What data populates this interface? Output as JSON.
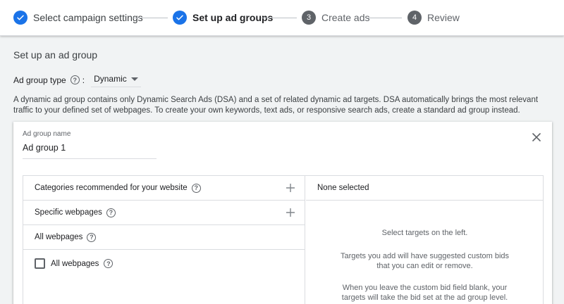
{
  "stepper": {
    "steps": [
      {
        "label": "Select campaign settings",
        "status": "done",
        "number": "1"
      },
      {
        "label": "Set up ad groups",
        "status": "active-done",
        "number": "2"
      },
      {
        "label": "Create ads",
        "status": "pending",
        "number": "3"
      },
      {
        "label": "Review",
        "status": "pending",
        "number": "4"
      }
    ]
  },
  "section": {
    "title": "Set up an ad group",
    "type_label": "Ad group type",
    "type_colon": ":",
    "type_value": "Dynamic",
    "description": "A dynamic ad group contains only Dynamic Search Ads (DSA) and a set of related dynamic ad targets. DSA automatically brings the most relevant traffic to your defined set of webpages. To create your own keywords, text ads, or responsive search ads, create a standard ad group instead."
  },
  "card": {
    "name_label": "Ad group name",
    "name_value": "Ad group 1"
  },
  "targets": {
    "rows": [
      {
        "label": "Categories recommended for your website"
      },
      {
        "label": "Specific webpages"
      },
      {
        "label": "All webpages"
      }
    ],
    "checkbox_label": "All webpages",
    "checkbox_checked": false,
    "selected_header": "None selected",
    "msg_select": "Select targets on the left.",
    "msg_bids_1": "Targets you add will have suggested custom bids",
    "msg_bids_2": "that you can edit or remove.",
    "msg_blank_1": "When you leave the custom bid field blank, your",
    "msg_blank_2": "targets will take the bid set at the ad group level."
  },
  "icons": {
    "check": "check-icon",
    "help": "help-circle-icon",
    "close": "close-icon",
    "add": "plus-icon",
    "dropdown": "caret-down-icon"
  },
  "colors": {
    "accent": "#1a73e8",
    "pending_step": "#5f6368",
    "border": "#dadce0",
    "background": "#f1f3f4"
  }
}
